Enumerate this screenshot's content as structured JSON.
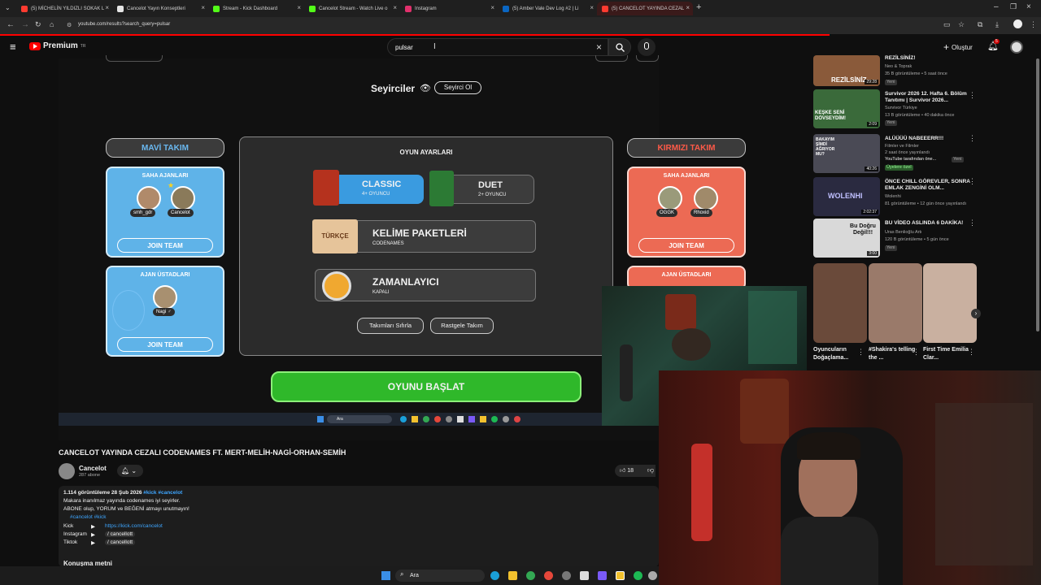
{
  "browser": {
    "tabs": [
      {
        "label": "(5) MİCHELİN YILDIZLI SOKAK L",
        "color": "#ff3b30"
      },
      {
        "label": "Cancelot Yayın Konseptleri",
        "color": "#e5e5e5"
      },
      {
        "label": "Stream - Kick Dashboard",
        "color": "#53fc18"
      },
      {
        "label": "Cancelot Stream - Watch Live o",
        "color": "#53fc18"
      },
      {
        "label": "Instagram",
        "color": "#e1306c"
      },
      {
        "label": "(5) Amber Vale Dev Log #2 | Li",
        "color": "#0a66c2"
      },
      {
        "label": "(5) CANCELOT YAYINDA CEZAL",
        "color": "#ff3b30"
      }
    ],
    "url": "youtube.com/results?search_query=pulsar"
  },
  "youtube": {
    "logo": "Premium",
    "logo_sup": "TR",
    "search_value": "pulsar",
    "create_label": "Oluştur",
    "notif_count": "5"
  },
  "game": {
    "spectators_label": "Seyirciler",
    "spectator_btn": "Seyirci Ol",
    "blue_team": "MAVİ TAKIM",
    "red_team": "KIRMIZI TAKIM",
    "field_agents": "SAHA AJANLARI",
    "spymasters": "AJAN ÜSTADLARI",
    "join_team": "JOIN TEAM",
    "blue_agents": [
      "smh_gdr",
      "Cancelot"
    ],
    "blue_spymaster": "Nagi ♂",
    "red_agents": [
      "OGGK",
      "Rhoxid"
    ],
    "settings_title": "OYUN AYARLARI",
    "mode_classic": "CLASSIC",
    "mode_classic_sub": "4+ OYUNCU",
    "mode_duet": "DUET",
    "mode_duet_sub": "2+ OYUNCU",
    "word_packs": "KELİME PAKETLERİ",
    "word_packs_sub": "CODENAMES",
    "word_pack_tag": "TÜRKÇE",
    "timer": "ZAMANLAYICI",
    "timer_sub": "KAPALI",
    "reset_teams": "Takımları Sıfırla",
    "random_team": "Rastgele Takım",
    "start_game": "OYUNU BAŞLAT",
    "inner_search": "Ara"
  },
  "video_info": {
    "title": "CANCELOT YAYINDA CEZALI CODENAMES FT. MERT-MELİH-NAGİ-ORHAN-SEMİH",
    "channel": "Cancelot",
    "subs": "287 abone",
    "likes": "18",
    "stats": "1.114 görüntüleme  28 Şub 2026",
    "tags": "#kick #cancelot",
    "desc1": "Makara inanılmaz yayında codenames iyi seyirler.",
    "desc2": "ABONE olup, YORUM ve BEĞENİ atmayı unutmayın!",
    "desc_tags": "#cancelot #kick",
    "kick_label": "Kick",
    "kick_link": "https://kick.com/cancelot",
    "insta_label": "Instagram",
    "insta_handle": "/ cancellott",
    "tiktok_label": "Tiktok",
    "tiktok_handle": "/ cancellott",
    "comments_heading": "Konuşma metni"
  },
  "sidebar": {
    "items": [
      {
        "title": "REZİLSİNİZ!",
        "channel": "Neo & Toprak",
        "meta": "35 B görüntüleme • 5 saat önce",
        "badge": "Yeni",
        "duration": "29:28",
        "thumb_text": "REZİLSİNİZ",
        "color": "#8a5a3a"
      },
      {
        "title": "Survivor 2026 12. Hafta 6. Bölüm Tanıtımı | Survivor 2026...",
        "channel": "Survivor Türkiye",
        "meta": "13 B görüntüleme • 40 dakika önce",
        "badge": "Yeni",
        "duration": "2:09",
        "thumb_text": "KEŞKE SENİ DÖVSEYDİM!",
        "color": "#3a6a3a"
      },
      {
        "title": "ALÜÜÜÜ NABEEERR!!!",
        "channel": "Filmler ve Filmler",
        "meta": "2 saat önce yayınlandı",
        "extra": "YouTube tarafından öne...",
        "badge": "Yeni",
        "member": "Üyelere özel",
        "duration": "40:26",
        "thumb_text": "BAKAYIM ŞİMDİ AĞRIYOR MU?",
        "color": "#4a4a55"
      },
      {
        "title": "ÖNCE CHILL GÖREVLER, SONRA EMLAK ZENGİNİ OLM...",
        "channel": "Wolenhi",
        "meta": "81 görüntüleme • 12 gün önce yayınlandı",
        "duration": "2:02:37",
        "thumb_text": "WOLENHI",
        "color": "#2a2a40"
      },
      {
        "title": "BU VİDEO ASLINDA 6 DAKİKA!",
        "channel": "Uras Benlioğlu Artı",
        "meta": "120 B görüntüleme • 5 gün önce",
        "badge": "Yeni",
        "duration": "3:00",
        "thumb_text": "Bu Doğru Değil!!!",
        "color": "#d9d9d9"
      }
    ],
    "shorts": [
      {
        "title": "Oyuncuların Doğaçlama...",
        "color": "#6a4a3a"
      },
      {
        "title": "#Shakira's telling the ...",
        "color": "#9a7a6a"
      },
      {
        "title": "First Time Emilia Clar...",
        "color": "#c9b0a0"
      }
    ]
  },
  "taskbar": {
    "search": "Ara"
  }
}
